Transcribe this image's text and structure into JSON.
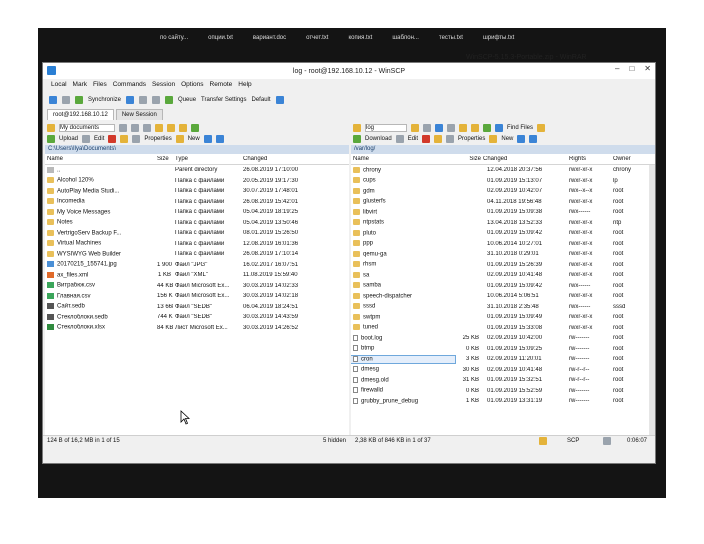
{
  "background": {
    "taskbar_items": [
      "по сайту...",
      "опции.txt",
      "вариант.doc",
      "отчет.txt",
      "копия.txt",
      "шаблон...",
      "тесты.txt",
      "шрифты.txt"
    ],
    "winrar_title": "WinSCP-5.15.3-Portable.zip - WinRAR"
  },
  "window": {
    "title": "log - root@192.168.10.12 - WinSCP",
    "min": "–",
    "max": "□",
    "close": "✕"
  },
  "menu": [
    "Local",
    "Mark",
    "Files",
    "Commands",
    "Session",
    "Options",
    "Remote",
    "Help"
  ],
  "toolbar": {
    "synchronize": "Synchronize",
    "queue": "Queue",
    "transfer_settings_label": "Transfer Settings",
    "transfer_settings_value": "Default"
  },
  "tabs": [
    {
      "label": "root@192.168.10.12"
    },
    {
      "label": "New Session"
    }
  ],
  "left": {
    "location": "My documents",
    "upload": "Upload",
    "edit": "Edit",
    "properties": "Properties",
    "new": "New",
    "path": "C:\\Users\\Ilya\\Documents\\",
    "columns": [
      "Name",
      "Size",
      "Type",
      "Changed"
    ],
    "rows": [
      {
        "icon": "up",
        "name": "..",
        "size": "",
        "type": "Parent directory",
        "changed": "26.08.2019  17:10:00"
      },
      {
        "icon": "folder",
        "name": "Alcohol 120%",
        "size": "",
        "type": "Папка с файлами",
        "changed": "20.05.2019  19:17:30"
      },
      {
        "icon": "folder",
        "name": "AutoPlay Media Studi...",
        "size": "",
        "type": "Папка с файлами",
        "changed": "30.07.2019  17:48:01"
      },
      {
        "icon": "folder",
        "name": "Incomedia",
        "size": "",
        "type": "Папка с файлами",
        "changed": "26.08.2019  15:42:01"
      },
      {
        "icon": "folder",
        "name": "My Voice Messages",
        "size": "",
        "type": "Папка с файлами",
        "changed": "05.04.2019  18:19:25"
      },
      {
        "icon": "folder",
        "name": "Notes",
        "size": "",
        "type": "Папка с файлами",
        "changed": "05.04.2019  13:50:46"
      },
      {
        "icon": "folder",
        "name": "VertrigoServ Backup F...",
        "size": "",
        "type": "Папка с файлами",
        "changed": "08.01.2019  15:26:50"
      },
      {
        "icon": "folder",
        "name": "Virtual Machines",
        "size": "",
        "type": "Папка с файлами",
        "changed": "12.08.2019  16:01:36"
      },
      {
        "icon": "folder",
        "name": "WYSIWYG Web Builder",
        "size": "",
        "type": "Папка с файлами",
        "changed": "26.08.2019  17:10:14"
      },
      {
        "icon": "img",
        "name": "20170215_155741.jpg",
        "size": "1 900 KB",
        "type": "Файл \"JPG\"",
        "changed": "16.02.2017  16:07:51"
      },
      {
        "icon": "xml",
        "name": "ax_files.xml",
        "size": "1 KB",
        "type": "Файл \"XML\"",
        "changed": "11.08.2019  15:59:40"
      },
      {
        "icon": "csv",
        "name": "Витрабюк.csv",
        "size": "44 KB",
        "type": "Файл Microsoft Ex...",
        "changed": "30.03.2019  14:02:33"
      },
      {
        "icon": "csv",
        "name": "Главная.csv",
        "size": "156 KB",
        "type": "Файл Microsoft Ex...",
        "changed": "30.03.2019  14:02:18"
      },
      {
        "icon": "sdb",
        "name": "Сайт.sedb",
        "size": "13 668 KB",
        "type": "Файл \"SEDB\"",
        "changed": "06.04.2019  18:24:51"
      },
      {
        "icon": "sdb",
        "name": "Стеклоблоки.sedb",
        "size": "744 KB",
        "type": "Файл \"SEDB\"",
        "changed": "30.03.2019  14:43:59"
      },
      {
        "icon": "xls",
        "name": "Стеклоблоки.xlsx",
        "size": "84 KB",
        "type": "Лист Microsoft Ex...",
        "changed": "30.03.2019  14:26:52"
      }
    ],
    "status": "124 B of 16,2 MB in 1 of 15",
    "hidden": "5 hidden"
  },
  "right": {
    "location": "log",
    "download": "Download",
    "edit": "Edit",
    "properties": "Properties",
    "new": "New",
    "find": "Find Files",
    "path": "/var/log/",
    "columns": [
      "Name",
      "Size",
      "Changed",
      "Rights",
      "Owner"
    ],
    "rows": [
      {
        "icon": "folder",
        "name": "chrony",
        "size": "",
        "changed": "12.04.2018 20:37:56",
        "rights": "rwxr-xr-x",
        "owner": "chrony"
      },
      {
        "icon": "folder",
        "name": "cups",
        "size": "",
        "changed": "01.09.2019 15:13:07",
        "rights": "rwxr-xr-x",
        "owner": "lp"
      },
      {
        "icon": "folder",
        "name": "gdm",
        "size": "",
        "changed": "02.09.2019 10:42:07",
        "rights": "rwx--x--x",
        "owner": "root"
      },
      {
        "icon": "folder",
        "name": "glusterfs",
        "size": "",
        "changed": "04.11.2018 19:56:48",
        "rights": "rwxr-xr-x",
        "owner": "root"
      },
      {
        "icon": "folder",
        "name": "libvirt",
        "size": "",
        "changed": "01.09.2019 15:09:38",
        "rights": "rwx------",
        "owner": "root"
      },
      {
        "icon": "folder",
        "name": "ntpstats",
        "size": "",
        "changed": "13.04.2018 13:52:33",
        "rights": "rwxr-xr-x",
        "owner": "ntp"
      },
      {
        "icon": "folder",
        "name": "pluto",
        "size": "",
        "changed": "01.09.2019 15:09:42",
        "rights": "rwxr-xr-x",
        "owner": "root"
      },
      {
        "icon": "folder",
        "name": "ppp",
        "size": "",
        "changed": "10.06.2014 10:27:01",
        "rights": "rwxr-xr-x",
        "owner": "root"
      },
      {
        "icon": "folder",
        "name": "qemu-ga",
        "size": "",
        "changed": "31.10.2018 0:29:01",
        "rights": "rwxr-xr-x",
        "owner": "root"
      },
      {
        "icon": "folder",
        "name": "rhsm",
        "size": "",
        "changed": "01.09.2019 15:26:39",
        "rights": "rwxr-xr-x",
        "owner": "root"
      },
      {
        "icon": "folder",
        "name": "sa",
        "size": "",
        "changed": "02.09.2019 10:41:48",
        "rights": "rwxr-xr-x",
        "owner": "root"
      },
      {
        "icon": "folder",
        "name": "samba",
        "size": "",
        "changed": "01.09.2019 15:09:42",
        "rights": "rwx------",
        "owner": "root"
      },
      {
        "icon": "folder",
        "name": "speech-dispatcher",
        "size": "",
        "changed": "10.06.2014 5:06:51",
        "rights": "rwxr-xr-x",
        "owner": "root"
      },
      {
        "icon": "folder",
        "name": "sssd",
        "size": "",
        "changed": "31.10.2018 2:35:48",
        "rights": "rwx------",
        "owner": "sssd"
      },
      {
        "icon": "folder",
        "name": "swtpm",
        "size": "",
        "changed": "01.09.2019 15:09:49",
        "rights": "rwxr-xr-x",
        "owner": "root"
      },
      {
        "icon": "folder",
        "name": "tuned",
        "size": "",
        "changed": "01.09.2019 15:33:08",
        "rights": "rwxr-xr-x",
        "owner": "root"
      },
      {
        "icon": "file",
        "name": "boot.log",
        "size": "25 KB",
        "changed": "02.09.2019 10:42:00",
        "rights": "rw-------",
        "owner": "root"
      },
      {
        "icon": "file",
        "name": "btmp",
        "size": "0 KB",
        "changed": "01.09.2019 15:09:25",
        "rights": "rw-------",
        "owner": "root"
      },
      {
        "icon": "file",
        "name": "cron",
        "size": "3 KB",
        "changed": "02.09.2019 11:20:01",
        "rights": "rw-------",
        "owner": "root",
        "selected": true
      },
      {
        "icon": "file",
        "name": "dmesg",
        "size": "30 KB",
        "changed": "02.09.2019 10:41:48",
        "rights": "rw-r--r--",
        "owner": "root"
      },
      {
        "icon": "file",
        "name": "dmesg.old",
        "size": "31 KB",
        "changed": "01.09.2019 15:32:51",
        "rights": "rw-r--r--",
        "owner": "root"
      },
      {
        "icon": "file",
        "name": "firewalld",
        "size": "0 KB",
        "changed": "01.09.2019 15:52:59",
        "rights": "rw-------",
        "owner": "root"
      },
      {
        "icon": "file",
        "name": "grubby_prune_debug",
        "size": "1 KB",
        "changed": "01.09.2019 13:31:19",
        "rights": "rw-------",
        "owner": "root"
      }
    ],
    "status": "2,38 KB of 846 KB in 1 of 37",
    "protocol": "SCP",
    "timer": "0:06:07"
  }
}
